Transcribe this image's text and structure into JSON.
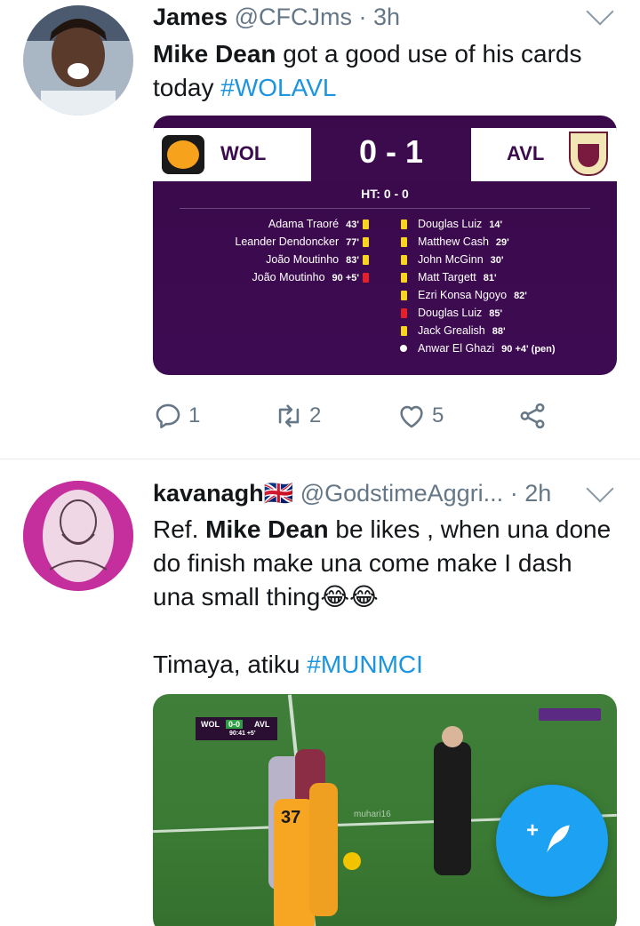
{
  "tweets": [
    {
      "name": "James",
      "handle": "@CFCJms",
      "separator": "·",
      "time": "3h",
      "text": {
        "bold": "Mike Dean",
        "rest": " got a good use of his cards today ",
        "hashtag": "#WOLAVL"
      },
      "scoreboard": {
        "home": "WOL",
        "away": "AVL",
        "score": "0 - 1",
        "halftime": "HT: 0 - 0",
        "home_events": [
          {
            "player": "Adama Traoré",
            "minute": "43'",
            "card": "yellow"
          },
          {
            "player": "Leander Dendoncker",
            "minute": "77'",
            "card": "yellow"
          },
          {
            "player": "João Moutinho",
            "minute": "83'",
            "card": "yellow"
          },
          {
            "player": "João Moutinho",
            "minute": "90 +5'",
            "card": "red"
          }
        ],
        "away_events": [
          {
            "player": "Douglas Luiz",
            "minute": "14'",
            "card": "yellow"
          },
          {
            "player": "Matthew Cash",
            "minute": "29'",
            "card": "yellow"
          },
          {
            "player": "John McGinn",
            "minute": "30'",
            "card": "yellow"
          },
          {
            "player": "Matt Targett",
            "minute": "81'",
            "card": "yellow"
          },
          {
            "player": "Ezri Konsa Ngoyo",
            "minute": "82'",
            "card": "yellow"
          },
          {
            "player": "Douglas Luiz",
            "minute": "85'",
            "card": "red"
          },
          {
            "player": "Jack Grealish",
            "minute": "88'",
            "card": "yellow"
          },
          {
            "player": "Anwar El Ghazi",
            "minute": "90 +4' (pen)",
            "card": "goal"
          }
        ]
      },
      "actions": {
        "replies": "1",
        "retweets": "2",
        "likes": "5"
      }
    },
    {
      "name": "kavanagh🇬🇧",
      "handle": "@GodstimeAggri...",
      "separator": "·",
      "time": "2h",
      "text": {
        "prefix": "Ref. ",
        "bold": "Mike Dean",
        "rest": " be likes , when una done do finish make una come make I dash una small thing😂😂",
        "line2": "Timaya, atiku ",
        "hashtag": "#MUNMCI"
      },
      "photo": {
        "home": "WOL",
        "score": "0-0",
        "away": "AVL",
        "clock": "90:41 +5'",
        "shirt_number": "37",
        "watermark": "muhari16"
      }
    }
  ],
  "colors": {
    "link": "#1b95e0",
    "fab": "#1da1f2",
    "secondary_text": "#657786",
    "premier_league_purple": "#3b0b4e"
  },
  "icons": [
    "reply-icon",
    "retweet-icon",
    "like-icon",
    "share-icon",
    "compose-tweet-icon",
    "caret-down-icon"
  ]
}
